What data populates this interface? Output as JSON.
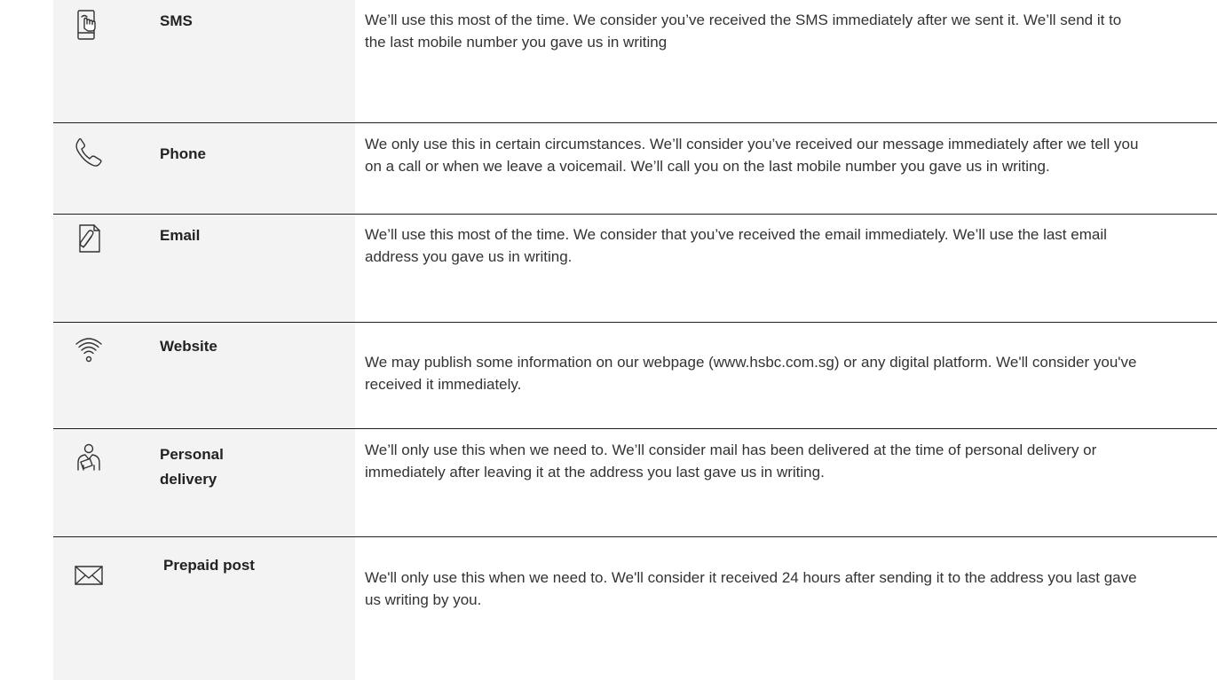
{
  "rows": [
    {
      "icon": "phone-tap-icon",
      "label": "SMS",
      "description": "We’ll use this most of the time. We consider you’ve received the SMS immediately after we sent it. We’ll send it to the last mobile number you gave us in writing"
    },
    {
      "icon": "phone-handset-icon",
      "label": "Phone",
      "description": "We only use this in certain circumstances. We’ll consider you’ve received our message immediately after we tell you on a call or when we leave a voicemail. We’ll call you on the last mobile number you gave us in writing."
    },
    {
      "icon": "attachment-document-icon",
      "label": "Email",
      "description": "We’ll use this most of the time. We consider that you’ve received the email immediately. We’ll use the last email address you gave us in writing."
    },
    {
      "icon": "wifi-icon",
      "label": "Website",
      "description": "We may publish some information on our webpage (www.hsbc.com.sg) or any digital platform. We'll consider you've received it immediately."
    },
    {
      "icon": "delivery-person-icon",
      "label": "Personal delivery",
      "description": "We’ll only use this when we need to. We’ll consider mail has been delivered at the time of personal delivery or immediately after leaving it at the address you last gave us in writing."
    },
    {
      "icon": "envelope-icon",
      "label": "Prepaid post",
      "description": "We'll only use this when we need to. We'll consider it received 24 hours after sending it to the address you last gave us writing by you."
    }
  ]
}
